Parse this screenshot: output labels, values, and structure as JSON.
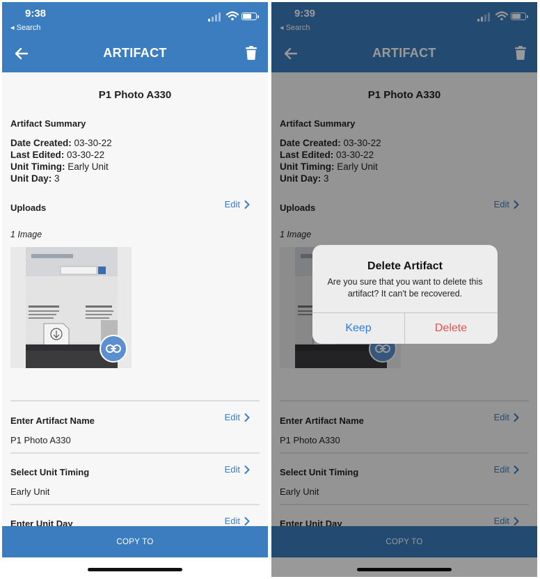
{
  "screens": [
    {
      "status": {
        "time": "9:38",
        "back_label": "◂ Search"
      },
      "nav": {
        "title": "ARTIFACT"
      },
      "artifact": {
        "title": "P1 Photo A330",
        "summary_heading": "Artifact Summary",
        "date_created_label": "Date Created:",
        "date_created": "03-30-22",
        "last_edited_label": "Last Edited:",
        "last_edited": "03-30-22",
        "unit_timing_label": "Unit Timing:",
        "unit_timing": "Early Unit",
        "unit_day_label": "Unit Day:",
        "unit_day": "3"
      },
      "uploads": {
        "heading": "Uploads",
        "edit_label": "Edit",
        "image_count": "1 Image"
      },
      "fields": {
        "name": {
          "heading": "Enter Artifact Name",
          "edit_label": "Edit",
          "value": "P1 Photo A330"
        },
        "timing": {
          "heading": "Select Unit Timing",
          "edit_label": "Edit",
          "value": "Early Unit"
        },
        "day": {
          "heading": "Enter Unit Day",
          "edit_label": "Edit"
        }
      },
      "copy_to_label": "COPY TO"
    },
    {
      "status": {
        "time": "9:39",
        "back_label": "◂ Search"
      },
      "nav": {
        "title": "ARTIFACT"
      },
      "artifact": {
        "title": "P1 Photo A330",
        "summary_heading": "Artifact Summary",
        "date_created_label": "Date Created:",
        "date_created": "03-30-22",
        "last_edited_label": "Last Edited:",
        "last_edited": "03-30-22",
        "unit_timing_label": "Unit Timing:",
        "unit_timing": "Early Unit",
        "unit_day_label": "Unit Day:",
        "unit_day": "3"
      },
      "uploads": {
        "heading": "Uploads",
        "edit_label": "Edit",
        "image_count": "1 Image"
      },
      "fields": {
        "name": {
          "heading": "Enter Artifact Name",
          "edit_label": "Edit",
          "value": "P1 Photo A330"
        },
        "timing": {
          "heading": "Select Unit Timing",
          "edit_label": "Edit",
          "value": "Early Unit"
        },
        "day": {
          "heading": "Enter Unit Day",
          "edit_label": "Edit"
        }
      },
      "copy_to_label": "COPY TO",
      "dialog": {
        "title": "Delete Artifact",
        "message": "Are you sure that you want to delete this artifact? It can't be recovered.",
        "keep_label": "Keep",
        "delete_label": "Delete"
      }
    }
  ],
  "colors": {
    "primary": "#3b7dbf",
    "link_badge": "#5b8fcf",
    "dialog_keep": "#2b78e4",
    "dialog_delete": "#e94c4c",
    "overlay": "rgba(0,0,0,0.4)"
  },
  "icons": [
    "back-arrow-icon",
    "trash-icon",
    "chevron-right-icon",
    "link-icon",
    "signal-icon",
    "wifi-icon",
    "battery-icon",
    "download-icon"
  ]
}
